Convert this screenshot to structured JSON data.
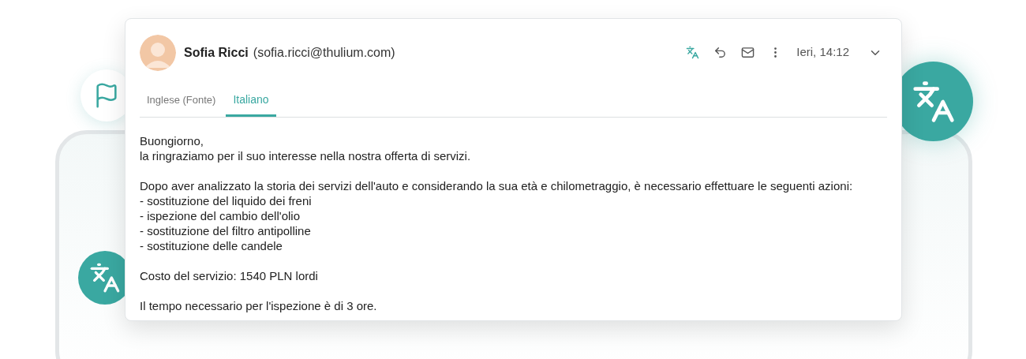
{
  "sender": {
    "name": "Sofia Ricci",
    "email": "(sofia.ricci@thulium.com)"
  },
  "toolbar": {
    "translate_active": true,
    "timestamp": "Ieri, 14:12"
  },
  "tabs": [
    {
      "label": "Inglese (Fonte)",
      "selected": false
    },
    {
      "label": "Italiano",
      "selected": true
    }
  ],
  "body": [
    [
      "Buongiorno,",
      "la ringraziamo per il suo interesse nella nostra offerta di servizi."
    ],
    [
      "Dopo aver analizzato la storia dei servizi dell'auto e considerando la sua età e chilometraggio, è necessario effettuare le seguenti azioni:",
      "- sostituzione del liquido dei freni",
      "- ispezione del cambio dell'olio",
      "- sostituzione del filtro antipolline",
      "- sostituzione delle candele"
    ],
    [
      "Costo del servizio: 1540 PLN lordi"
    ],
    [
      "Il tempo necessario per l'ispezione è di 3 ore."
    ]
  ]
}
